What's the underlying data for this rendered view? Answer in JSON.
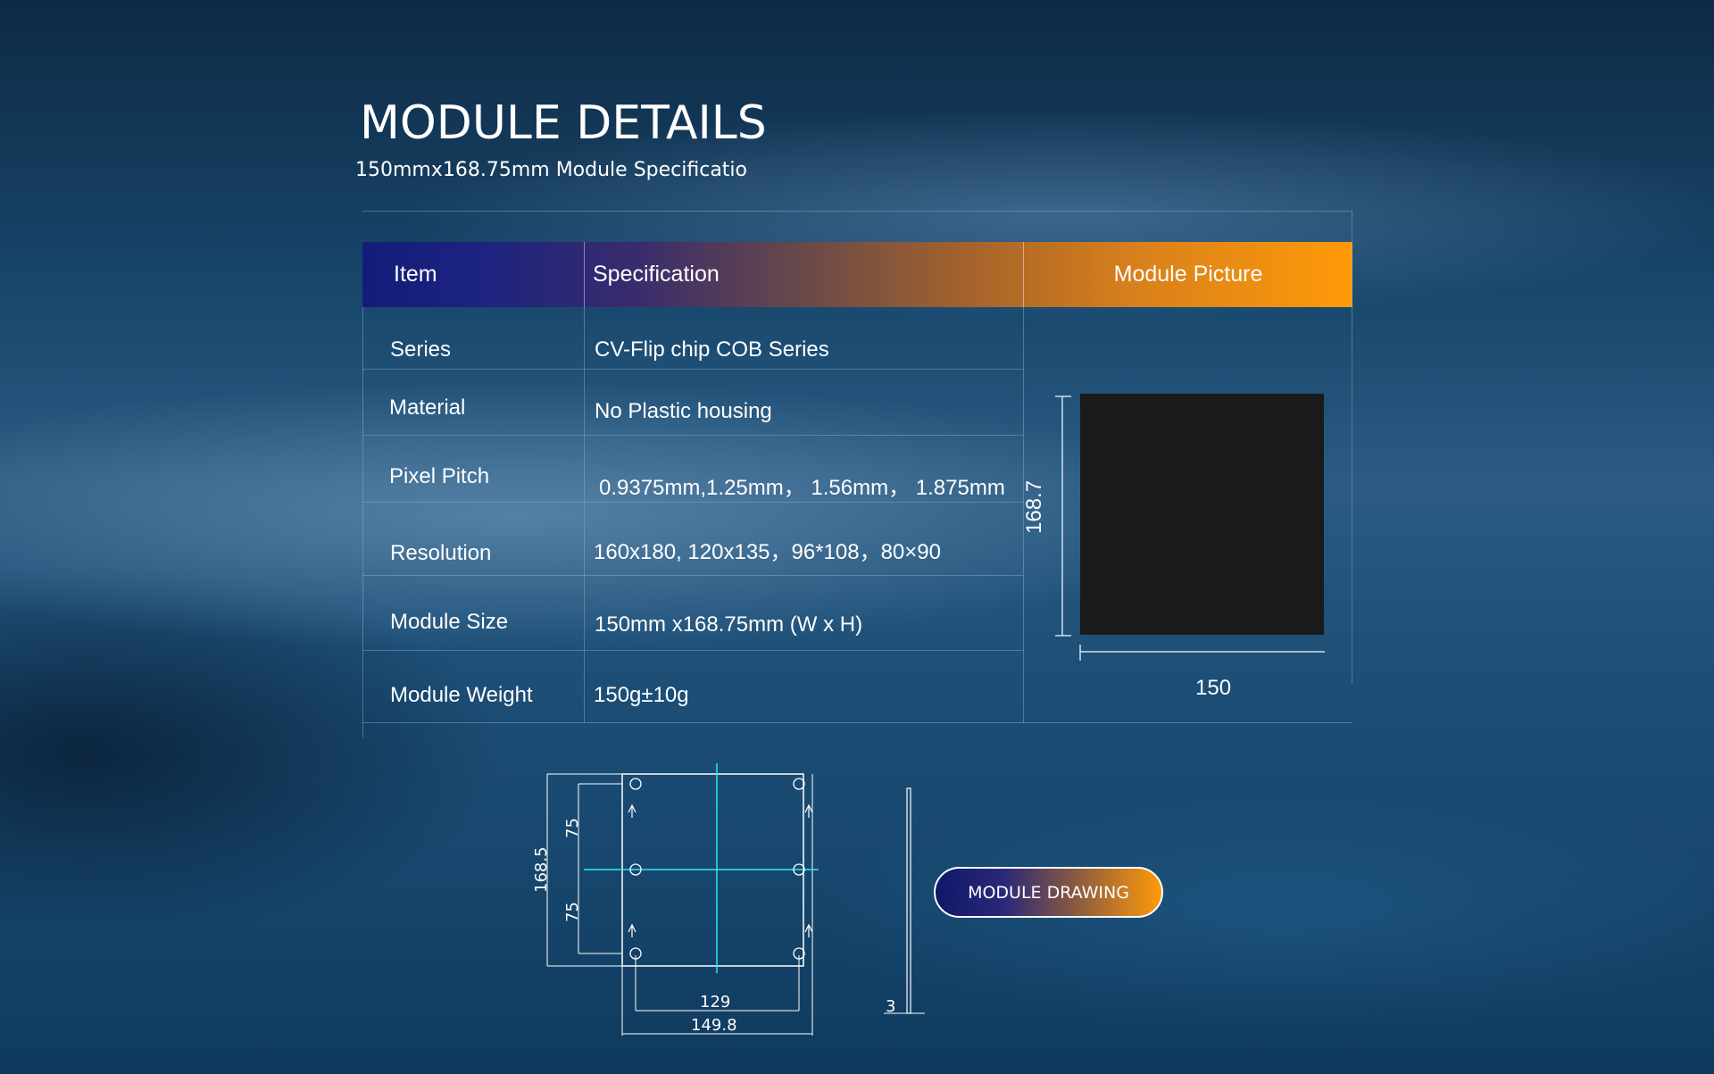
{
  "heading": {
    "title": "MODULE DETAILS",
    "subtitle": "150mmx168.75mm  Module Specificatio"
  },
  "table": {
    "headers": {
      "item": "Item",
      "specification": "Specification",
      "picture": "Module Picture"
    },
    "rows": [
      {
        "item": "Series",
        "spec": "CV-Flip chip COB Series"
      },
      {
        "item": "Material",
        "spec": "No Plastic housing"
      },
      {
        "item": "Pixel Pitch",
        "spec": "0.9375mm,1.25mm，  1.56mm，  1.875mm"
      },
      {
        "item": "Resolution",
        "spec": "160x180, 120x135，96*108，80×90"
      },
      {
        "item": "Module Size",
        "spec": "150mm x168.75mm (W x H)"
      },
      {
        "item": "Module Weight",
        "spec": "150g±10g"
      }
    ]
  },
  "picture": {
    "height_label": "168.7",
    "width_label": "150"
  },
  "drawing": {
    "height_label": "168.5",
    "upper_half_label": "75",
    "lower_half_label": "75",
    "hole_span_label": "129",
    "width_label": "149.8",
    "thickness_label": "3"
  },
  "button": {
    "label": "MODULE DRAWING"
  },
  "colors": {
    "header_start": "#141c7a",
    "header_end": "#ff9a08",
    "accent_cyan": "#2ee6f0"
  }
}
